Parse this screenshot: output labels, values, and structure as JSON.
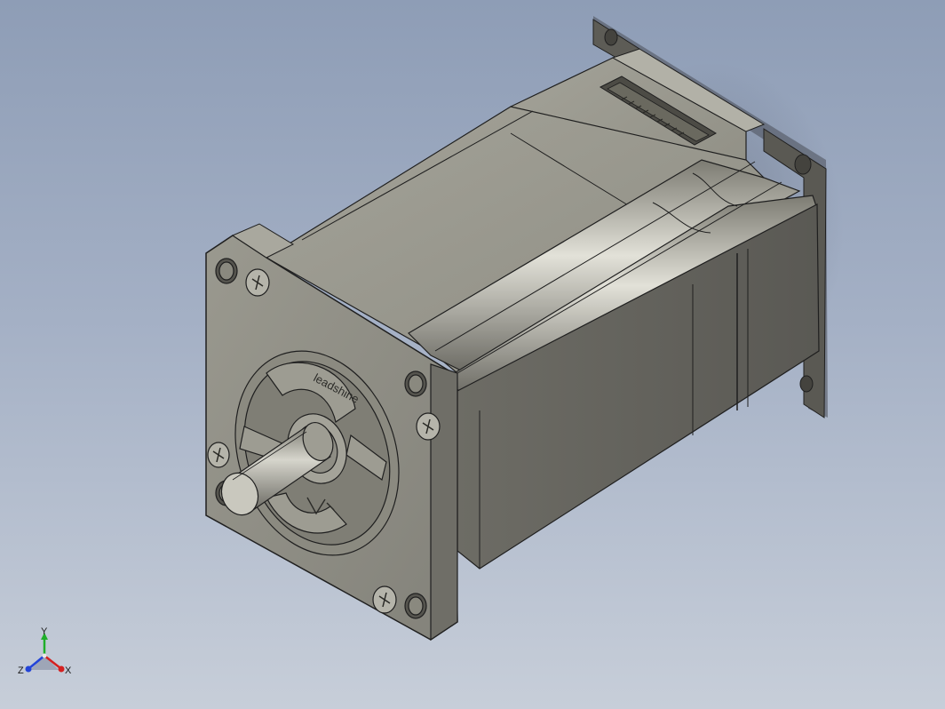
{
  "viewport": {
    "background_top": "#8e9db6",
    "background_bottom": "#c7ced9"
  },
  "model": {
    "part_color": "#8a8a80",
    "edge_color": "#1f1f1f",
    "face_logo_text": "leadshine"
  },
  "triad": {
    "x_label": "X",
    "y_label": "Y",
    "z_label": "Z",
    "x_color": "#d42020",
    "y_color": "#1fae2a",
    "z_color": "#2244d8"
  }
}
